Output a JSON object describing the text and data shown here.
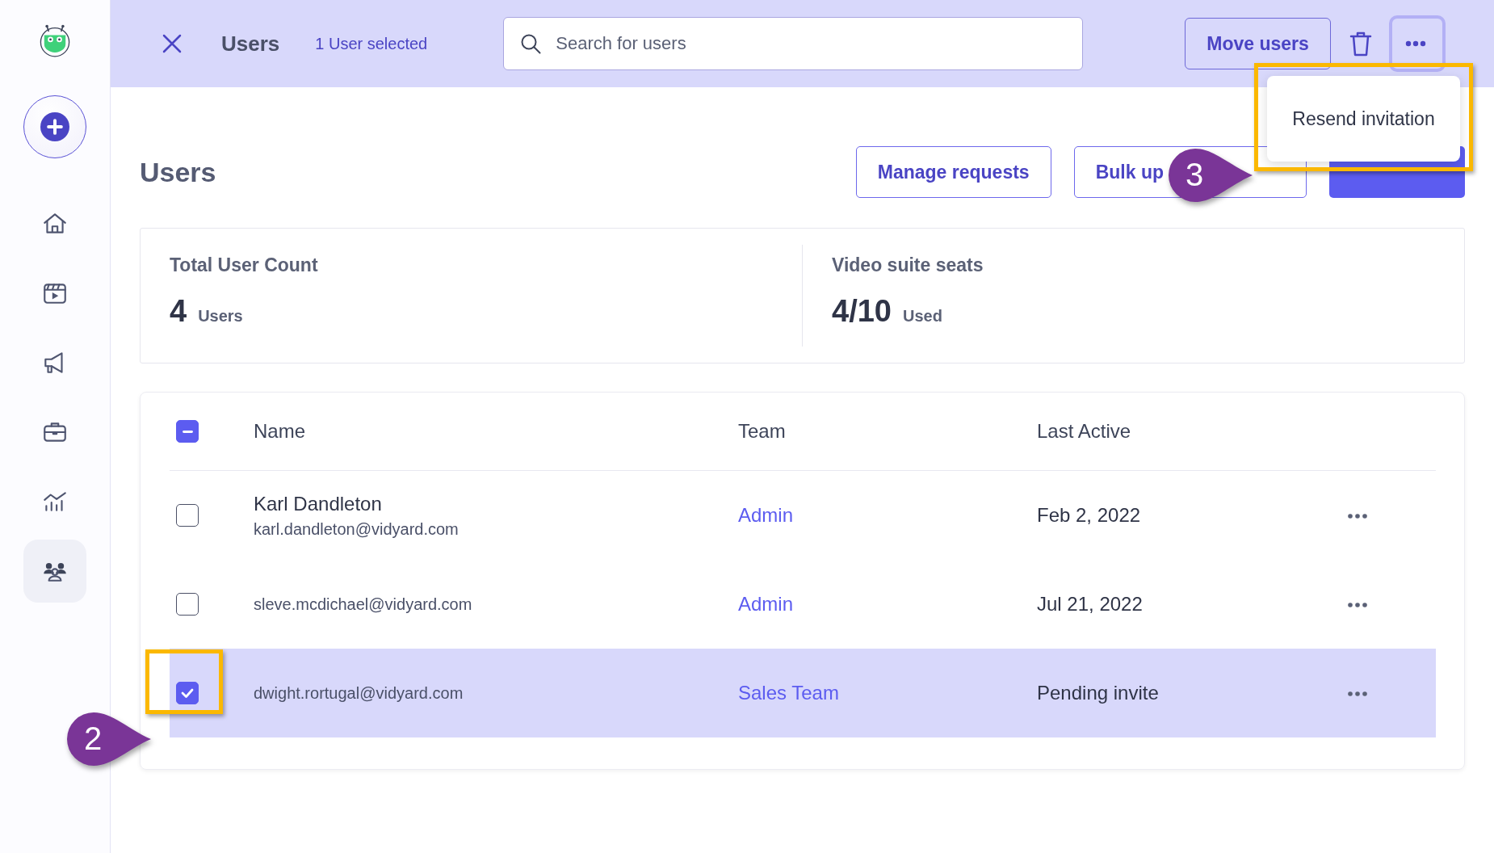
{
  "sidebar": {
    "items": [
      {
        "kind": "home",
        "selected": false
      },
      {
        "kind": "video",
        "selected": false
      },
      {
        "kind": "megaphone",
        "selected": false
      },
      {
        "kind": "briefcase",
        "selected": false
      },
      {
        "kind": "analytics",
        "selected": false
      },
      {
        "kind": "users",
        "selected": true
      }
    ]
  },
  "selection_bar": {
    "title": "Users",
    "count": "1 User selected",
    "search": {
      "placeholder": "Search for users"
    },
    "move_button": "Move users"
  },
  "more_menu": {
    "expanded": true,
    "items": [
      "Resend invitation"
    ],
    "callout": "3"
  },
  "page": {
    "title": "Users",
    "actions": [
      {
        "kind": "outline",
        "label": "Manage requests"
      },
      {
        "kind": "outline",
        "label": "Bulk up",
        "covered_end": true
      },
      {
        "kind": "primary"
      }
    ]
  },
  "stats": [
    {
      "label": "Total User Count",
      "value": "4",
      "unit": "Users"
    },
    {
      "label": "Video suite seats",
      "value": "4/10",
      "unit": "Used"
    }
  ],
  "table": {
    "select_all": {
      "indeterminate": true
    },
    "columns": [
      "Name",
      "Team",
      "Last Active"
    ],
    "rows": [
      {
        "name": "Karl Dandleton",
        "email": "karl.dandleton@vidyard.com",
        "team": "Admin",
        "last_active": "Feb 2, 2022",
        "selected": false
      },
      {
        "email": "sleve.mcdichael@vidyard.com",
        "team": "Admin",
        "last_active": "Jul 21, 2022",
        "selected": false
      },
      {
        "email": "dwight.rortugal@vidyard.com",
        "team": "Sales Team",
        "last_active": "Pending invite",
        "selected": true,
        "callout": "2"
      }
    ]
  }
}
